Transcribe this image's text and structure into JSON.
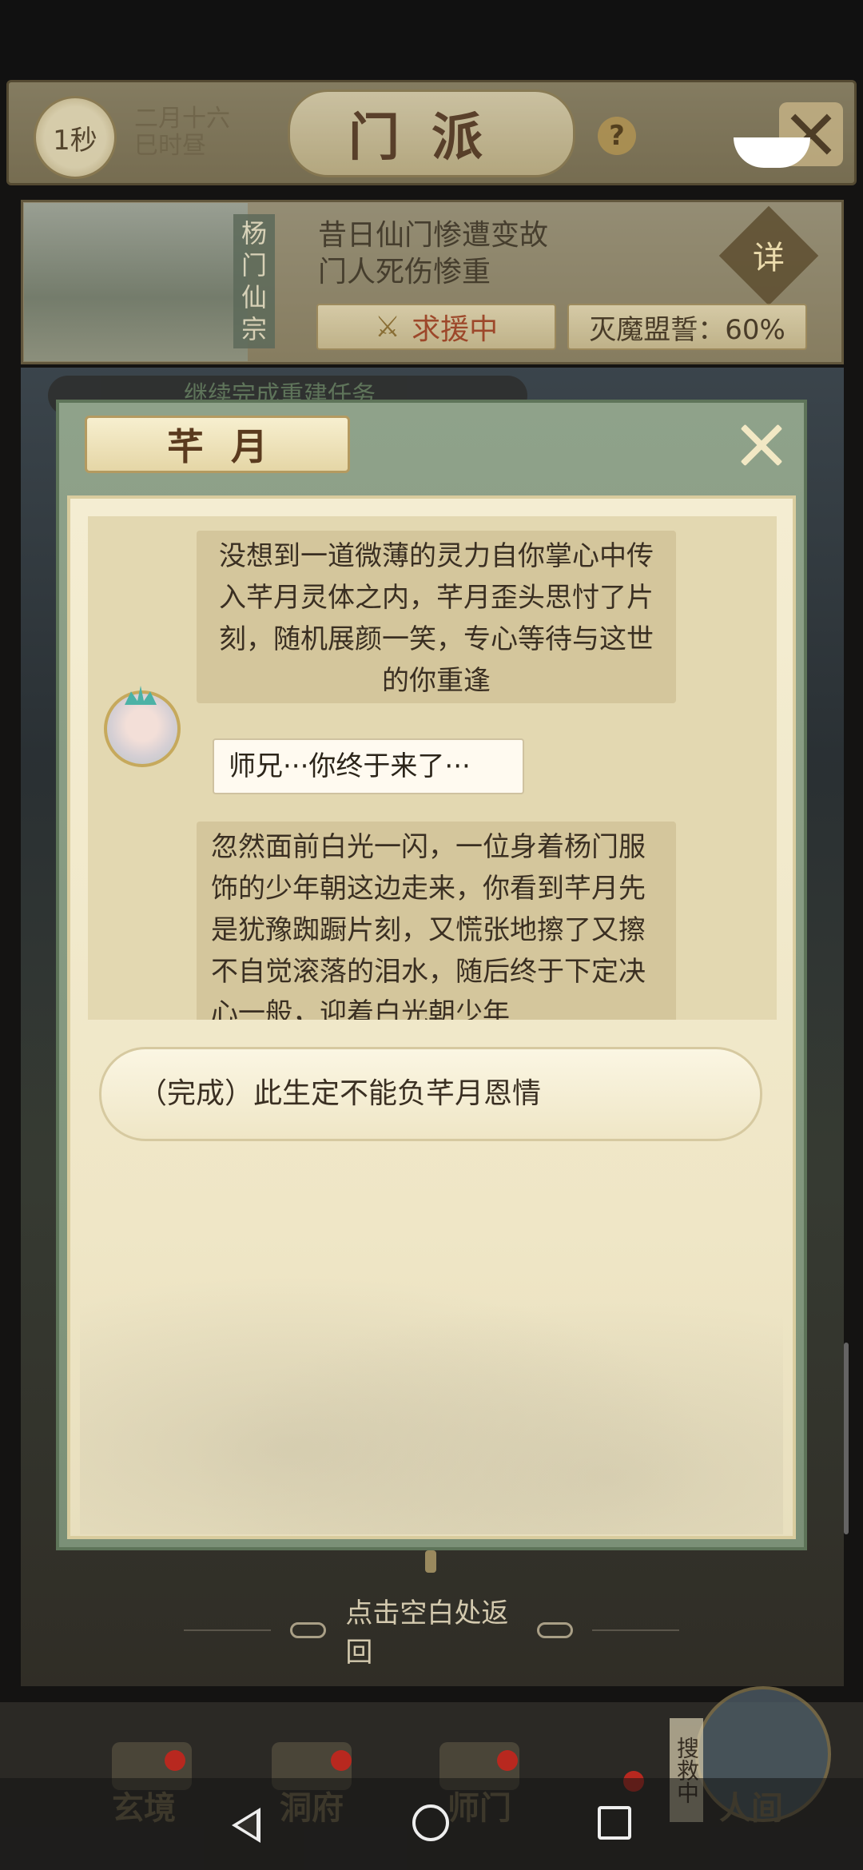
{
  "header": {
    "time_badge": "1秒",
    "date_line1": "二月十六",
    "date_line2": "巳时昼",
    "title": "门派",
    "help_icon": "?"
  },
  "sect": {
    "name": "杨门仙宗",
    "desc_line1": "昔日仙门惨遭变故",
    "desc_line2": "门人死伤惨重",
    "detail_label": "详",
    "rescue_label": "求援中",
    "pledge_label": "灭魔盟誓：60%"
  },
  "task_strip": "继续完成重建任务",
  "dialog": {
    "name": "芊月",
    "narration_1": "没想到一道微薄的灵力自你掌心中传入芊月灵体之内，芊月歪头思忖了片刻，随机展颜一笑，专心等待与这世的你重逢",
    "speech": "师兄···你终于来了···",
    "narration_2": "忽然面前白光一闪，一位身着杨门服饰的少年朝这边走来，你看到芊月先是犹豫踟蹰片刻，又慌张地擦了又擦不自觉滚落的泪水，随后终于下定决心一般，迎着白光朝少年",
    "choice": "（完成）此生定不能负芊月恩情",
    "tap_hint": "点击空白处返回"
  },
  "bottom_nav": {
    "items": [
      "玄境",
      "洞府",
      "师门",
      "人间"
    ],
    "rescue_tag": "搜救中"
  },
  "icons": {
    "close": "close-icon",
    "back": "back-icon",
    "home": "home-icon",
    "recents": "recents-icon"
  }
}
